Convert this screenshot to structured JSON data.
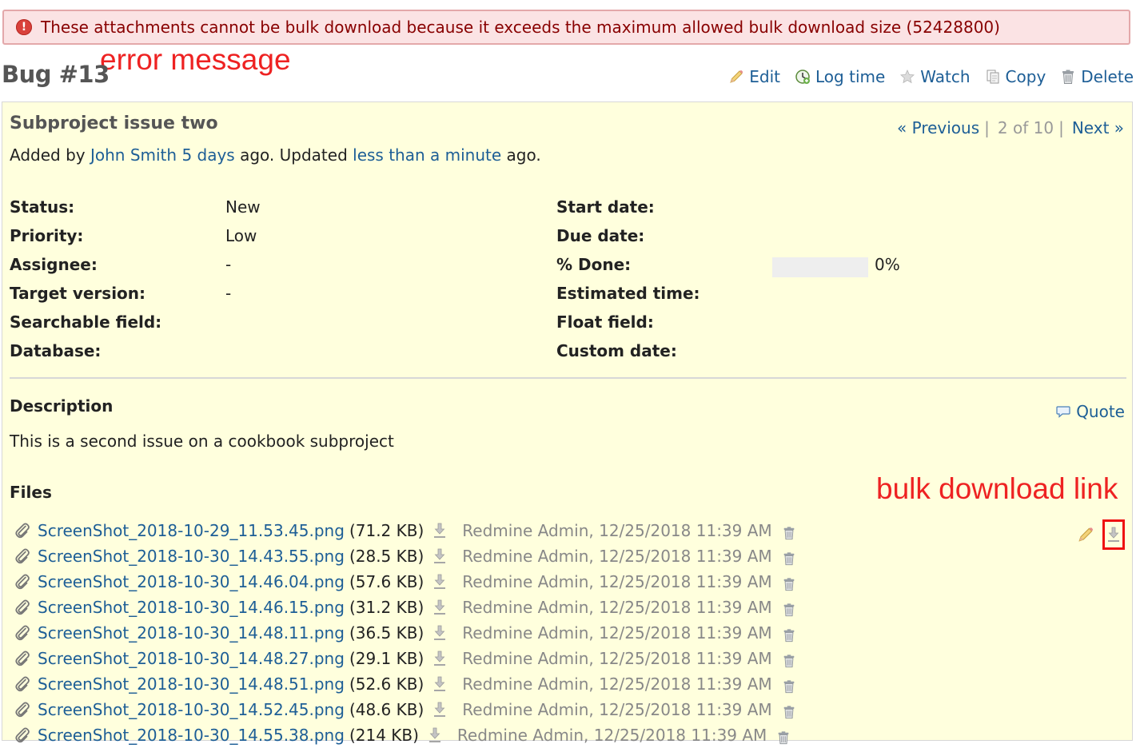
{
  "flash": {
    "message": "These attachments cannot be bulk download because it exceeds the maximum allowed bulk download size (52428800)",
    "icon": "error-icon",
    "icon_glyph": "!"
  },
  "annotations": {
    "error": "error message",
    "bulk": "bulk download link"
  },
  "page_title": "Bug #13",
  "toolbar": {
    "edit": "Edit",
    "log_time": "Log time",
    "watch": "Watch",
    "copy": "Copy",
    "delete": "Delete"
  },
  "issue": {
    "subject": "Subproject issue two",
    "added_by_prefix": "Added by ",
    "author": "John Smith",
    "created_ago": "5 days",
    "updated_text": " ago. Updated ",
    "updated_ago": "less than a minute",
    "suffix": " ago.",
    "prev": "« Previous",
    "position": "2 of 10",
    "next": "Next »",
    "separator": "|",
    "attributes_left": [
      {
        "label": "Status:",
        "value": "New"
      },
      {
        "label": "Priority:",
        "value": "Low"
      },
      {
        "label": "Assignee:",
        "value": "-"
      },
      {
        "label": "Target version:",
        "value": "-"
      },
      {
        "label": "Searchable field:",
        "value": ""
      },
      {
        "label": "Database:",
        "value": ""
      }
    ],
    "attributes_right": [
      {
        "label": "Start date:",
        "value": ""
      },
      {
        "label": "Due date:",
        "value": ""
      },
      {
        "label": "% Done:",
        "value": "0%",
        "progress": 0
      },
      {
        "label": "Estimated time:",
        "value": ""
      },
      {
        "label": "Float field:",
        "value": ""
      },
      {
        "label": "Custom date:",
        "value": ""
      }
    ],
    "description_heading": "Description",
    "quote": "Quote",
    "description": "This is a second issue on a cookbook subproject",
    "files_heading": "Files",
    "files": [
      {
        "name": "ScreenShot_2018-10-29_11.53.45.png",
        "size": "(71.2 KB)",
        "meta": "Redmine Admin, 12/25/2018 11:39 AM"
      },
      {
        "name": "ScreenShot_2018-10-30_14.43.55.png",
        "size": "(28.5 KB)",
        "meta": "Redmine Admin, 12/25/2018 11:39 AM"
      },
      {
        "name": "ScreenShot_2018-10-30_14.46.04.png",
        "size": "(57.6 KB)",
        "meta": "Redmine Admin, 12/25/2018 11:39 AM"
      },
      {
        "name": "ScreenShot_2018-10-30_14.46.15.png",
        "size": "(31.2 KB)",
        "meta": "Redmine Admin, 12/25/2018 11:39 AM"
      },
      {
        "name": "ScreenShot_2018-10-30_14.48.11.png",
        "size": "(36.5 KB)",
        "meta": "Redmine Admin, 12/25/2018 11:39 AM"
      },
      {
        "name": "ScreenShot_2018-10-30_14.48.27.png",
        "size": "(29.1 KB)",
        "meta": "Redmine Admin, 12/25/2018 11:39 AM"
      },
      {
        "name": "ScreenShot_2018-10-30_14.48.51.png",
        "size": "(52.6 KB)",
        "meta": "Redmine Admin, 12/25/2018 11:39 AM"
      },
      {
        "name": "ScreenShot_2018-10-30_14.52.45.png",
        "size": "(48.6 KB)",
        "meta": "Redmine Admin, 12/25/2018 11:39 AM"
      },
      {
        "name": "ScreenShot_2018-10-30_14.55.38.png",
        "size": "(214 KB)",
        "meta": "Redmine Admin, 12/25/2018 11:39 AM"
      }
    ]
  },
  "colors": {
    "link": "#1d5e96",
    "flash_bg": "#fbe3e4",
    "flash_text": "#880000",
    "issue_bg": "#ffffdd",
    "annotation": "#ee2222"
  }
}
